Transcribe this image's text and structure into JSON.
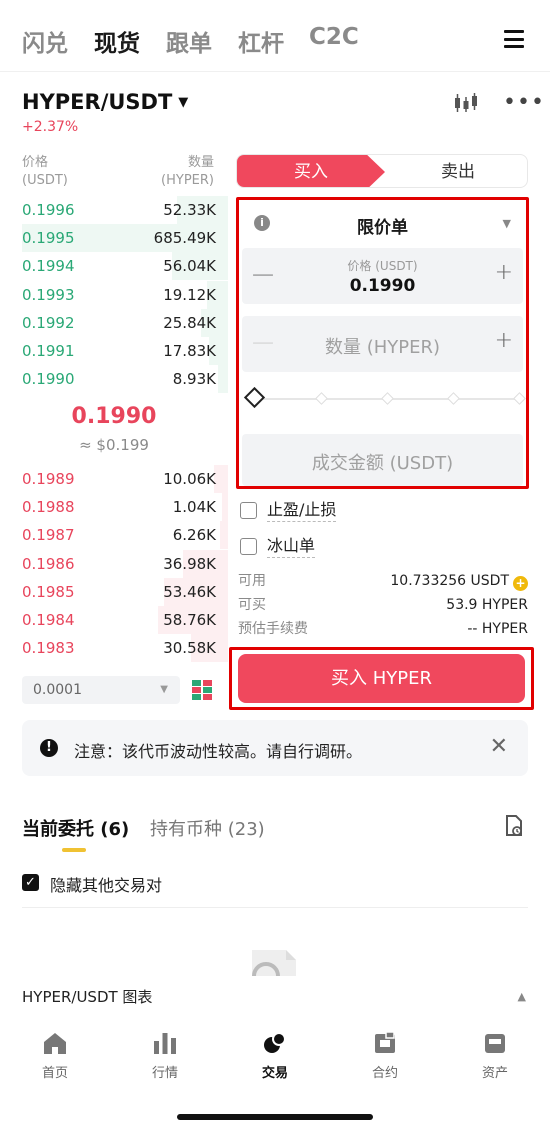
{
  "top_tabs": [
    "闪兑",
    "现货",
    "跟单",
    "杠杆",
    "C2C"
  ],
  "top_tab_active": "现货",
  "pair": {
    "name": "HYPER/USDT",
    "change": "+2.37%"
  },
  "orderbook": {
    "price_header": "价格",
    "price_unit": "(USDT)",
    "qty_header": "数量",
    "qty_unit": "(HYPER)",
    "asks": [
      {
        "price": "0.1996",
        "qty": "52.33K",
        "depth": 0.25
      },
      {
        "price": "0.1995",
        "qty": "685.49K",
        "depth": 1.0
      },
      {
        "price": "0.1994",
        "qty": "56.04K",
        "depth": 0.27
      },
      {
        "price": "0.1993",
        "qty": "19.12K",
        "depth": 0.1
      },
      {
        "price": "0.1992",
        "qty": "25.84K",
        "depth": 0.13
      },
      {
        "price": "0.1991",
        "qty": "17.83K",
        "depth": 0.09
      },
      {
        "price": "0.1990",
        "qty": "8.93K",
        "depth": 0.05
      }
    ],
    "mid_price": "0.1990",
    "mid_usd": "≈ $0.199",
    "bids": [
      {
        "price": "0.1989",
        "qty": "10.06K",
        "depth": 0.07
      },
      {
        "price": "0.1988",
        "qty": "1.04K",
        "depth": 0.01
      },
      {
        "price": "0.1987",
        "qty": "6.26K",
        "depth": 0.04
      },
      {
        "price": "0.1986",
        "qty": "36.98K",
        "depth": 0.22
      },
      {
        "price": "0.1985",
        "qty": "53.46K",
        "depth": 0.31
      },
      {
        "price": "0.1984",
        "qty": "58.76K",
        "depth": 0.34
      },
      {
        "price": "0.1983",
        "qty": "30.58K",
        "depth": 0.18
      }
    ],
    "precision": "0.0001"
  },
  "trade": {
    "buy_tab": "买入",
    "sell_tab": "卖出",
    "order_type": "限价单",
    "price_label": "价格 (USDT)",
    "price_value": "0.1990",
    "qty_placeholder": "数量 (HYPER)",
    "slider_percent": 0,
    "amount_placeholder": "成交金额 (USDT)",
    "tp_sl": "止盈/止损",
    "iceberg": "冰山单",
    "available_label": "可用",
    "available_value": "10.733256 USDT",
    "canbuy_label": "可买",
    "canbuy_value": "53.9 HYPER",
    "fee_label": "预估手续费",
    "fee_value": "-- HYPER",
    "buy_button": "买入 HYPER"
  },
  "notice": "注意：该代币波动性较高。请自行调研。",
  "orders": {
    "tab_open": "当前委托 (6)",
    "tab_hold": "持有币种 (23)",
    "hide_others": "隐藏其他交易对"
  },
  "chart_label": "HYPER/USDT 图表",
  "bottom_nav": [
    "首页",
    "行情",
    "交易",
    "合约",
    "资产"
  ],
  "bottom_nav_active": "交易",
  "colors": {
    "buy": "#f0485d",
    "green": "#2aa876",
    "red": "#e8455c",
    "highlight": "#e10000"
  }
}
